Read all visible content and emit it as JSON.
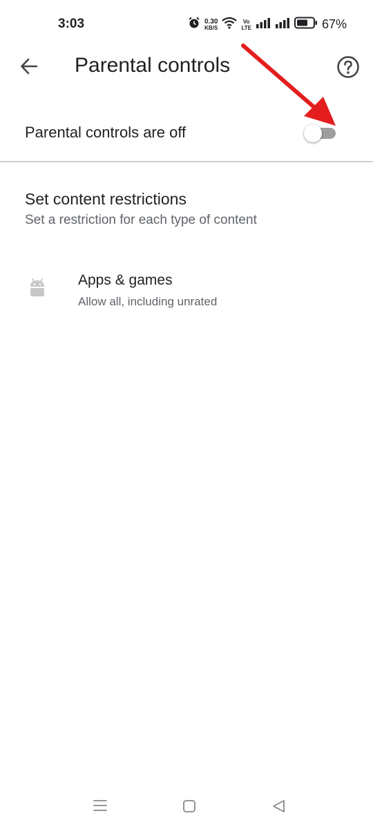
{
  "status_bar": {
    "time": "3:03",
    "net_speed_value": "0.30",
    "net_speed_unit": "KB/S",
    "volte_line1": "Vo",
    "volte_line2": "LTE",
    "battery_percent": "67%",
    "icons": [
      "alarm-icon",
      "wifi-icon",
      "volte-icon",
      "signal-icon",
      "signal-icon",
      "battery-icon"
    ]
  },
  "app_bar": {
    "title": "Parental controls",
    "back_icon": "arrow-back-icon",
    "help_icon": "help-circle-icon"
  },
  "toggle_row": {
    "label": "Parental controls are off",
    "state": "off"
  },
  "content_restrictions": {
    "title": "Set content restrictions",
    "subtitle": "Set a restriction for each type of content",
    "items": [
      {
        "icon": "android-icon",
        "title": "Apps & games",
        "subtitle": "Allow all, including unrated"
      }
    ]
  },
  "annotation": {
    "type": "red-arrow",
    "color": "#e41e1e",
    "points_to": "parental-controls-toggle"
  },
  "nav_bar": {
    "icons": [
      "menu-icon",
      "home-icon",
      "back-triangle-icon"
    ]
  },
  "colors": {
    "text_primary": "#202124",
    "text_secondary": "#5f6368",
    "toggle_track_off": "#9e9e9e",
    "annotation_red": "#e41e1e"
  }
}
